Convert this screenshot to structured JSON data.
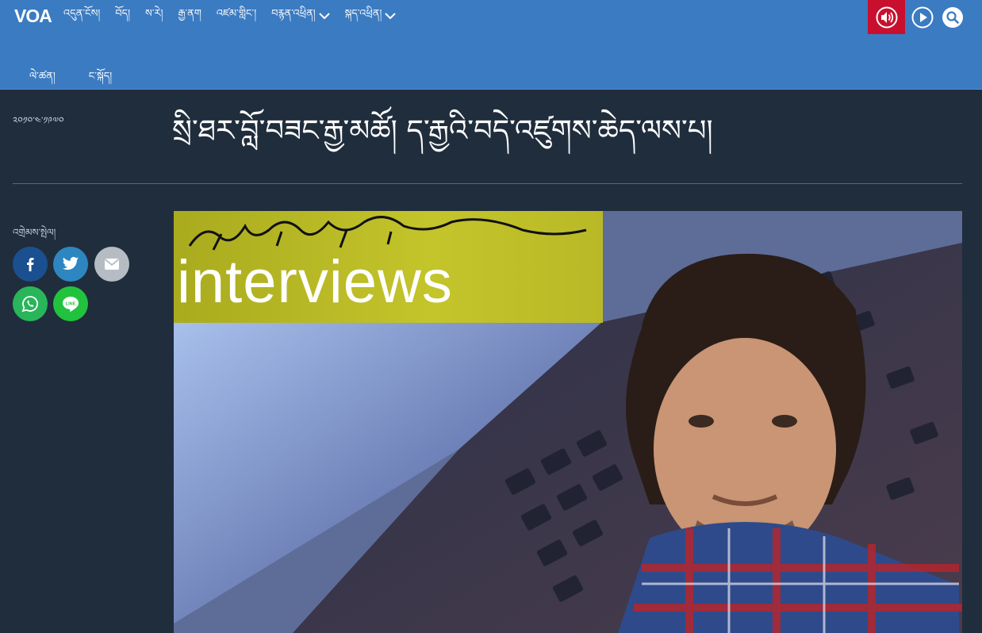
{
  "header": {
    "logo": "VOA",
    "nav": [
      {
        "label": "འདུན་ངོས།"
      },
      {
        "label": "བོད།"
      },
      {
        "label": "ས་རེ།"
      },
      {
        "label": "རྒྱ་ནག"
      },
      {
        "label": "འཛམ་གླིང་།"
      },
      {
        "label": "བརྙན་འཕྲིན།",
        "dropdown": true
      },
      {
        "label": "སྐད་འཕྲིན།",
        "dropdown": true
      }
    ],
    "tools": {
      "audio": "speaker-icon",
      "video": "play-icon",
      "search": "search-icon"
    }
  },
  "subnav": [
    "ལེ་ཚན།",
    "ང་སྐོད།"
  ],
  "article": {
    "date": "༢༠༡༠་༤་༡༩༧༠",
    "headline": "སྲི་ཐར་བློ་བཟང་རྒྱ་མཚོ། ད་རྒྱའི་བདེ་འཛུགས་ཆེད་ལས་པ།",
    "share_label": "འགྲེམས་སྤེལ།",
    "share_buttons": [
      "facebook-icon",
      "twitter-icon",
      "email-icon",
      "whatsapp-icon",
      "line-icon"
    ],
    "hero": {
      "banner_text": "interviews"
    }
  },
  "colors": {
    "nav_bg": "#3b7bc2",
    "page_bg": "#202d3c",
    "live_audio": "#c8102e"
  }
}
